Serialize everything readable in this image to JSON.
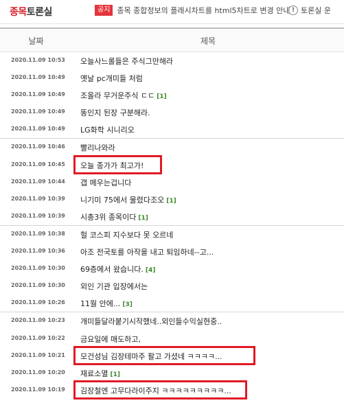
{
  "board": {
    "title_part1": "종목",
    "title_part2": "토론실"
  },
  "notice": {
    "badge": "공지",
    "text": "종목 종합정보의 플래시차트를 html5차트로 변경 안내"
  },
  "rules": {
    "icon": "info-icon",
    "text": "토론실 운"
  },
  "table_header": {
    "date": "날짜",
    "title": "제목"
  },
  "posts": [
    {
      "date": "2020.11.09 10:53",
      "title": "오늘사느롤들은 주식그만해라",
      "comments": "",
      "highlighted": false,
      "group_start": false
    },
    {
      "date": "2020.11.09 10:49",
      "title": "옛날 pc개미들 처럼",
      "comments": "",
      "highlighted": false,
      "group_start": false
    },
    {
      "date": "2020.11.09 10:49",
      "title": "조올라 무거운주식 ㄷㄷ",
      "comments": "[1]",
      "highlighted": false,
      "group_start": false
    },
    {
      "date": "2020.11.09 10:49",
      "title": "똥인지 된장 구분해라.",
      "comments": "",
      "highlighted": false,
      "group_start": false
    },
    {
      "date": "2020.11.09 10:49",
      "title": "LG화학 시니리오",
      "comments": "",
      "highlighted": false,
      "group_start": false
    },
    {
      "date": "2020.11.09 10:46",
      "title": "빨리나와라",
      "comments": "",
      "highlighted": false,
      "group_start": true
    },
    {
      "date": "2020.11.09 10:45",
      "title": "오늘 종가가 최고가!",
      "comments": "",
      "highlighted": true,
      "group_start": false
    },
    {
      "date": "2020.11.09 10:44",
      "title": "갭 메우는겁니다",
      "comments": "",
      "highlighted": false,
      "group_start": false
    },
    {
      "date": "2020.11.09 10:39",
      "title": "니기미 75에서 물렸다조오",
      "comments": "[1]",
      "highlighted": false,
      "group_start": false
    },
    {
      "date": "2020.11.09 10:39",
      "title": "시총3위 종목이다",
      "comments": "[1]",
      "highlighted": false,
      "group_start": false
    },
    {
      "date": "2020.11.09 10:38",
      "title": "헐 코스피 지수보다 못 오르네",
      "comments": "",
      "highlighted": false,
      "group_start": true
    },
    {
      "date": "2020.11.09 10:36",
      "title": "아조 전국토를 아작을 내고 퇴임하네--고...",
      "comments": "",
      "highlighted": false,
      "group_start": false
    },
    {
      "date": "2020.11.09 10:30",
      "title": "69층에서 왔습니다.",
      "comments": "[4]",
      "highlighted": false,
      "group_start": false
    },
    {
      "date": "2020.11.09 10:30",
      "title": "외인 기관 입장에서는",
      "comments": "",
      "highlighted": false,
      "group_start": false
    },
    {
      "date": "2020.11.09 10:26",
      "title": "11월 안에...",
      "comments": "[3]",
      "highlighted": false,
      "group_start": false
    },
    {
      "date": "2020.11.09 10:23",
      "title": "개미들달라붙기시작했네..외인들수익실현중..",
      "comments": "",
      "highlighted": false,
      "group_start": true
    },
    {
      "date": "2020.11.09 10:22",
      "title": "금요일에 매도하고,",
      "comments": "",
      "highlighted": false,
      "group_start": false
    },
    {
      "date": "2020.11.09 10:21",
      "title": "모건성님 김장테마주 팔고 가셨네 ㅋㅋㅋㅋ...",
      "comments": "",
      "highlighted": true,
      "group_start": false
    },
    {
      "date": "2020.11.09 10:20",
      "title": "재료소멸",
      "comments": "[1]",
      "highlighted": false,
      "group_start": false
    },
    {
      "date": "2020.11.09 10:19",
      "title": "김장철엔 고무다라이주지 ㅋㅋㅋㅋㅋㅋㅋㅋㅋ...",
      "comments": "",
      "highlighted": true,
      "group_start": false
    }
  ]
}
